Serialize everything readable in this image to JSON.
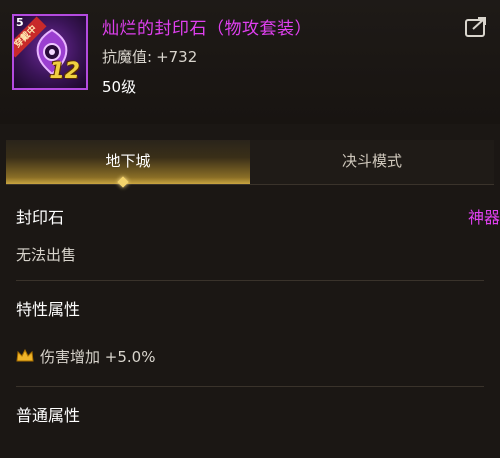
{
  "item": {
    "level_badge": "5",
    "ribbon": "穿戴中",
    "icon_number": "12",
    "name": "灿烂的封印石（物攻套装）",
    "magic_resist_label": "抗魔值:",
    "magic_resist_value": "+732",
    "level_requirement": "50级"
  },
  "tabs": [
    {
      "label": "地下城",
      "active": true
    },
    {
      "label": "决斗模式",
      "active": false
    }
  ],
  "details": {
    "type": "封印石",
    "rarity": "神器",
    "trade": "无法出售",
    "special_title": "特性属性",
    "special_props": [
      {
        "icon": "crown-icon",
        "text": "伤害增加 +5.0%"
      }
    ],
    "normal_title": "普通属性"
  },
  "colors": {
    "rarity": "#e040f0",
    "accent": "#c9a440"
  }
}
